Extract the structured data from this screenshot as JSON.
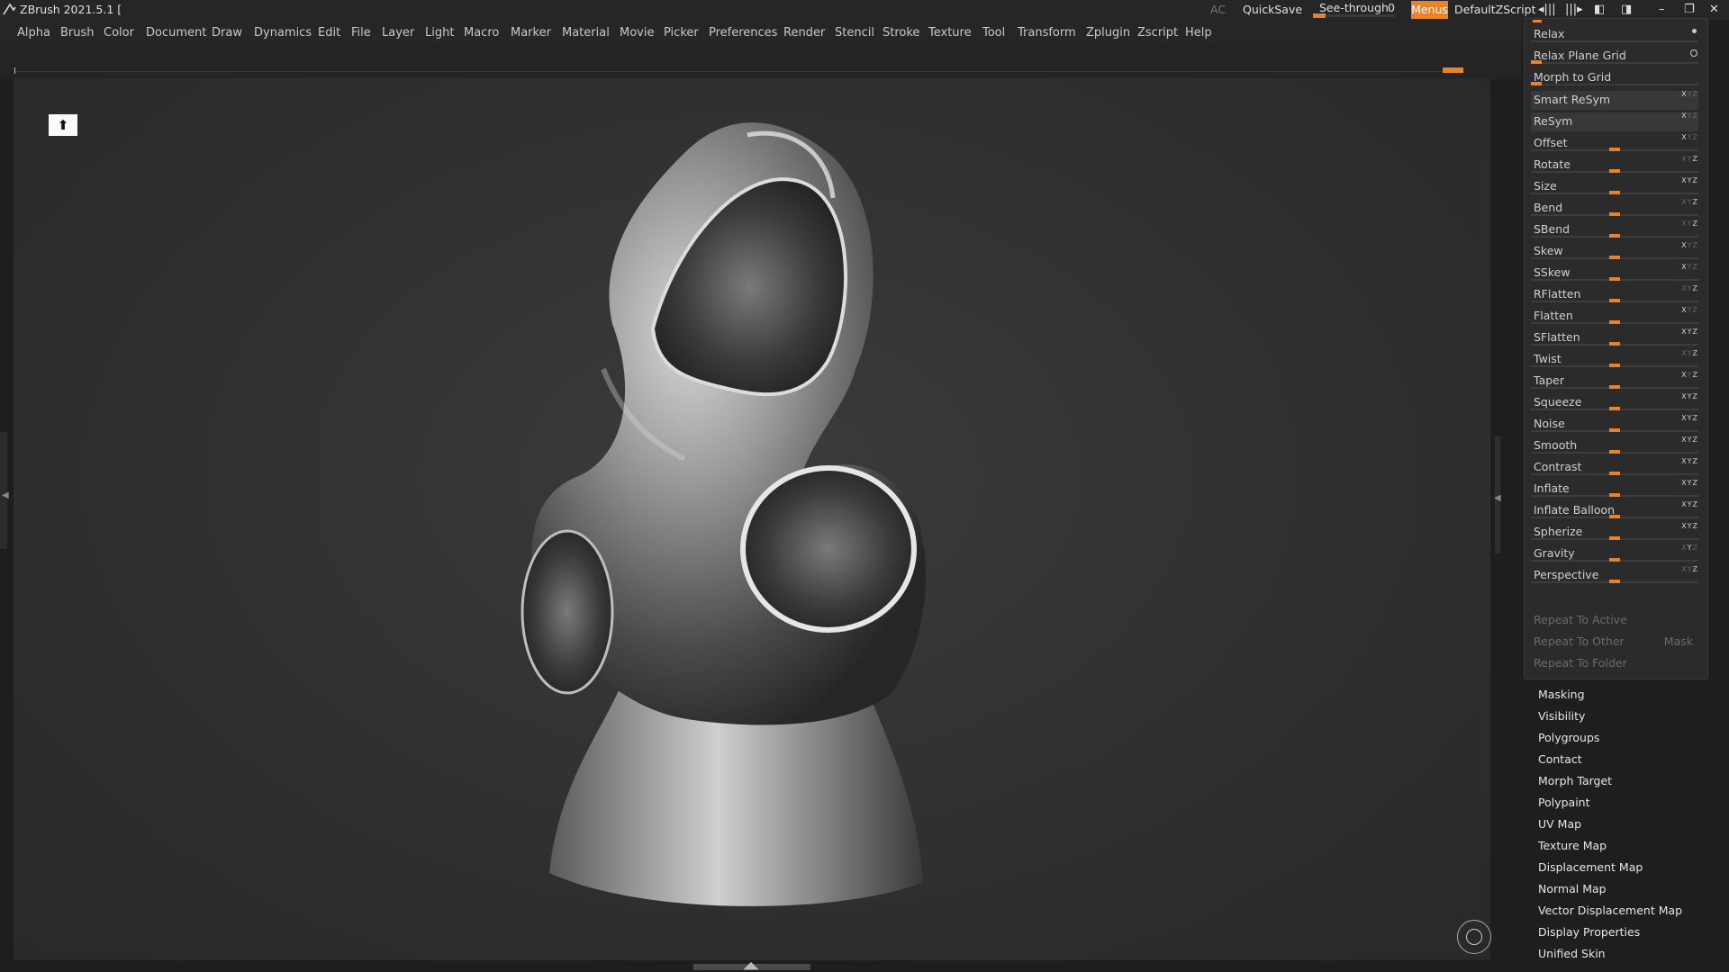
{
  "app": {
    "title": "ZBrush 2021.5.1 [",
    "ac": "AC",
    "quicksave": "QuickSave",
    "seethrough_label": "See-through",
    "seethrough_value": "0",
    "menus": "Menus",
    "script": "DefaultZScript"
  },
  "menu": [
    "Alpha",
    "Brush",
    "Color",
    "Document",
    "Draw",
    "Dynamics",
    "Edit",
    "File",
    "Layer",
    "Light",
    "Macro",
    "Marker",
    "Material",
    "Movie",
    "Picker",
    "Preferences",
    "Render",
    "Stencil",
    "Stroke",
    "Texture",
    "Tool",
    "Transform",
    "Zplugin",
    "Zscript",
    "Help"
  ],
  "deformation": {
    "items": [
      {
        "label": "Relax"
      },
      {
        "label": "Relax Plane Grid"
      },
      {
        "label": "Morph to Grid"
      },
      {
        "label": "Smart ReSym"
      },
      {
        "label": "ReSym"
      },
      {
        "label": "Offset"
      },
      {
        "label": "Rotate"
      },
      {
        "label": "Size"
      },
      {
        "label": "Bend"
      },
      {
        "label": "SBend"
      },
      {
        "label": "Skew"
      },
      {
        "label": "SSkew"
      },
      {
        "label": "RFlatten"
      },
      {
        "label": "Flatten"
      },
      {
        "label": "SFlatten"
      },
      {
        "label": "Twist"
      },
      {
        "label": "Taper"
      },
      {
        "label": "Squeeze"
      },
      {
        "label": "Noise"
      },
      {
        "label": "Smooth"
      },
      {
        "label": "Contrast"
      },
      {
        "label": "Inflate"
      },
      {
        "label": "Inflate Balloon"
      },
      {
        "label": "Spherize"
      },
      {
        "label": "Gravity"
      },
      {
        "label": "Perspective"
      }
    ],
    "repeat_active": "Repeat To Active",
    "repeat_other": "Repeat To Other",
    "mask": "Mask",
    "repeat_folder": "Repeat To Folder"
  },
  "subpalettes": [
    "Masking",
    "Visibility",
    "Polygroups",
    "Contact",
    "Morph Target",
    "Polypaint",
    "UV Map",
    "Texture Map",
    "Displacement Map",
    "Normal Map",
    "Vector Displacement Map",
    "Display Properties",
    "Unified Skin"
  ],
  "colors": {
    "accent": "#e8832a",
    "background": "#1e1e1e",
    "panel": "#2b2b2b",
    "canvas": "#303030"
  }
}
